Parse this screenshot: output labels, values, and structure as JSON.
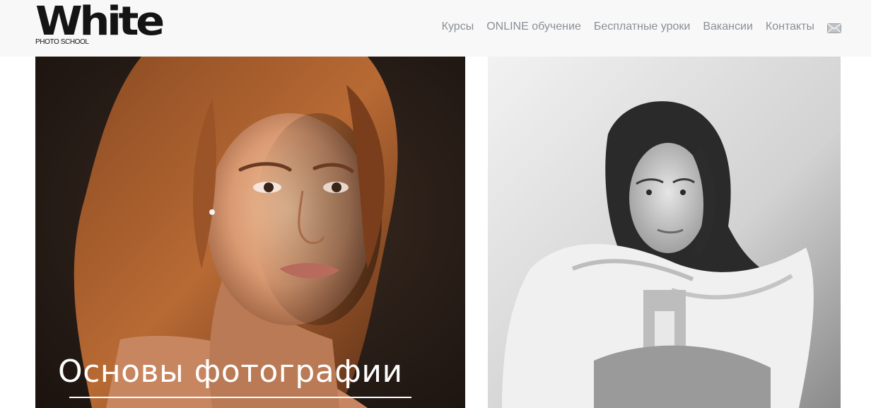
{
  "header": {
    "logo": {
      "word": "White",
      "sub": "PHOTO SCHOOL"
    },
    "nav": [
      {
        "label": "Курсы"
      },
      {
        "label": "ONLINE обучение"
      },
      {
        "label": "Бесплатные уроки"
      },
      {
        "label": "Вакансии"
      },
      {
        "label": "Контакты"
      }
    ],
    "mail_icon": "envelope-icon"
  },
  "cards": [
    {
      "caption": "Основы фотографии",
      "image": "color-portrait-photo"
    },
    {
      "caption": "",
      "image": "black-and-white-portrait-photo"
    }
  ],
  "colors": {
    "header_bg": "#f8f8f8",
    "nav_text": "#8a8f97",
    "logo": "#141414",
    "caption": "#ffffff"
  }
}
